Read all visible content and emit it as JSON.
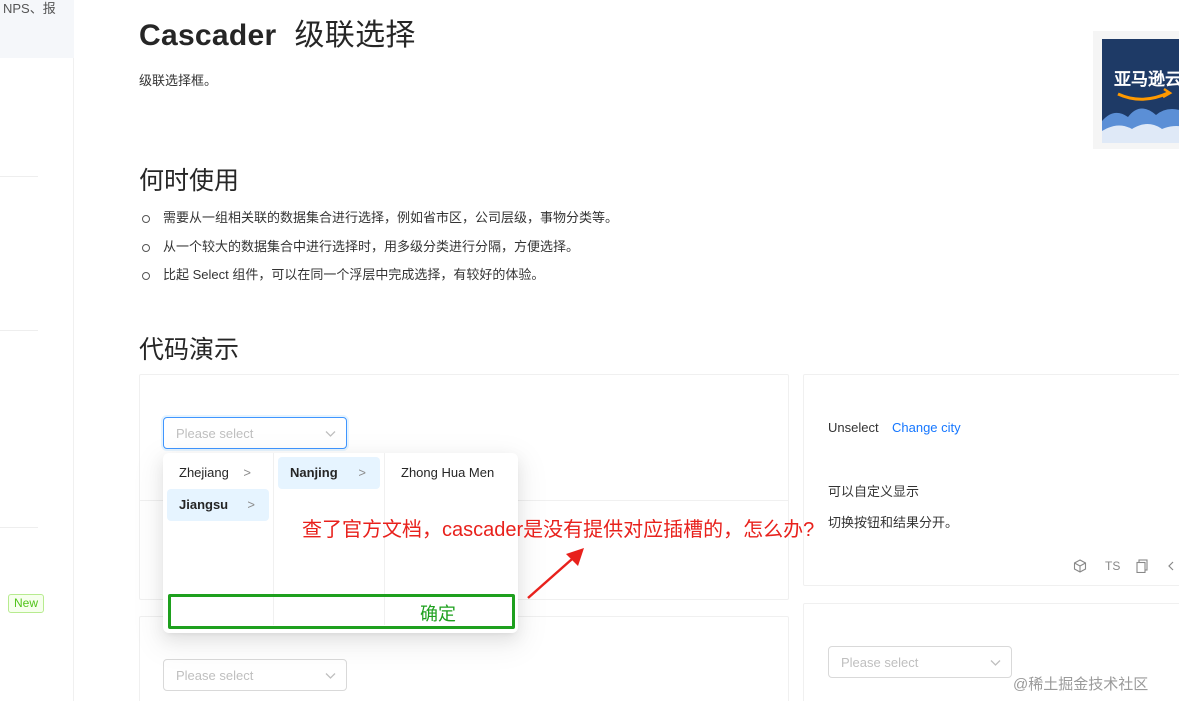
{
  "sidebar": {
    "top_text": "NPS、报",
    "new_badge": "New"
  },
  "page": {
    "title_en": "Cascader",
    "title_cn": "级联选择",
    "description": "级联选择框。",
    "when_heading": "何时使用",
    "bullets": [
      "需要从一组相关联的数据集合进行选择，例如省市区，公司层级，事物分类等。",
      "从一个较大的数据集合中进行选择时，用多级分类进行分隔，方便选择。",
      "比起 Select 组件，可以在同一个浮层中完成选择，有较好的体验。"
    ],
    "demo_heading": "代码演示"
  },
  "ad": {
    "text": "亚马逊云"
  },
  "demo": {
    "select_placeholder": "Please select",
    "unselect_label": "Unselect",
    "change_city_link": "Change city",
    "custom_display": "可以自定义显示",
    "toggle_desc": "切换按钮和结果分开。",
    "toolbar": [
      "TS"
    ]
  },
  "cascader": {
    "col1": [
      "Zhejiang",
      "Jiangsu"
    ],
    "col2": [
      "Nanjing"
    ],
    "col3": [
      "Zhong Hua Men"
    ],
    "arrow": ">"
  },
  "annotation": {
    "question": "查了官方文档，cascader是没有提供对应插槽的，怎么办?",
    "confirm": "确定",
    "arrow_color": "#e8211c",
    "box_color": "#1ea01e"
  },
  "watermark": "@稀土掘金技术社区"
}
